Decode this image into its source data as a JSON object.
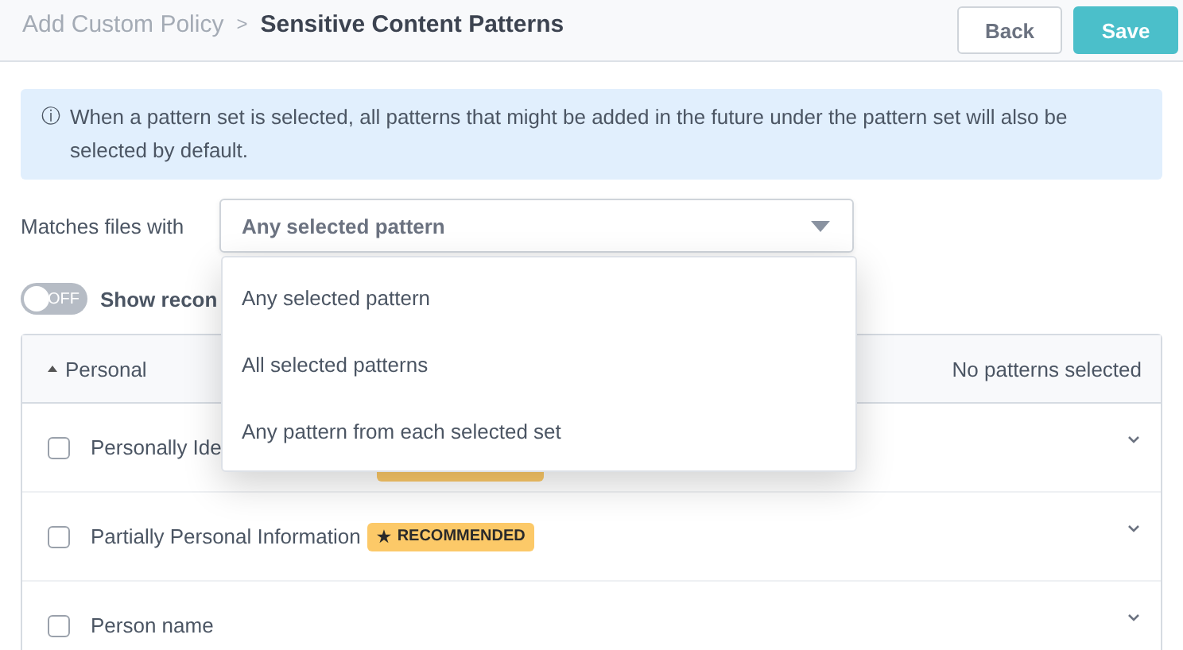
{
  "breadcrumb": {
    "parent": "Add Custom Policy",
    "separator": ">",
    "current": "Sensitive Content Patterns"
  },
  "buttons": [
    {
      "label": "Back",
      "kind": "secondary"
    },
    {
      "label": "Save",
      "kind": "primary"
    }
  ],
  "info": {
    "icon": "ⓘ",
    "text": "When a pattern set is selected, all patterns that might be added in the future under the pattern set will also be selected by default."
  },
  "matches": {
    "label": "Matches files with",
    "value": "Any selected pattern",
    "expanded": true,
    "options": [
      {
        "label": "Any selected pattern"
      },
      {
        "label": "All selected patterns"
      },
      {
        "label": "Any pattern from each selected set"
      }
    ]
  },
  "toggle": {
    "on": false,
    "state_label": "OFF",
    "label": "Show recon"
  },
  "group": {
    "name": "Personal",
    "expanded": true,
    "summary": "No patterns selected",
    "rows": [
      {
        "name": "Personally Ide",
        "checked": false,
        "recommended": true
      },
      {
        "name": "Partially Personal Information",
        "checked": false,
        "recommended": true,
        "badge_icon": "★",
        "badge": "RECOMMENDED"
      },
      {
        "name": "Person name",
        "checked": false,
        "recommended": false
      }
    ]
  }
}
